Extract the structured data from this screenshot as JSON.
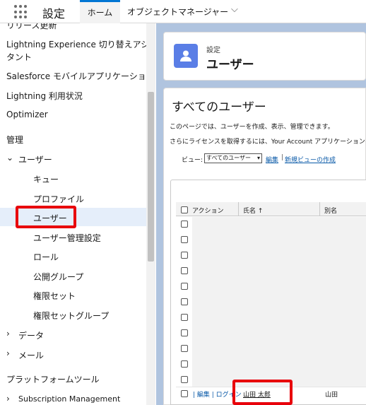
{
  "topbar": {
    "app_title": "設定",
    "tabs": [
      {
        "label": "ホーム",
        "active": true
      },
      {
        "label": "オブジェクトマネージャー",
        "active": false
      }
    ]
  },
  "sidebar": {
    "items": [
      {
        "label": "リリース更新"
      },
      {
        "label": "Lightning Experience 切り替えアシス"
      },
      {
        "label": "タント"
      },
      {
        "label": "Salesforce モバイルアプリケーション"
      },
      {
        "label": "Lightning 利用状況"
      },
      {
        "label": "Optimizer"
      },
      {
        "label": "管理"
      },
      {
        "label": "ユーザー",
        "expanded": true
      },
      {
        "label": "キュー"
      },
      {
        "label": "プロファイル"
      },
      {
        "label": "ユーザー",
        "selected": true
      },
      {
        "label": "ユーザー管理設定"
      },
      {
        "label": "ロール"
      },
      {
        "label": "公開グループ"
      },
      {
        "label": "権限セット"
      },
      {
        "label": "権限セットグループ"
      },
      {
        "label": "データ"
      },
      {
        "label": "メール"
      },
      {
        "label": "プラットフォームツール"
      },
      {
        "label": "Subscription Management"
      }
    ],
    "expand_glyph": "⌄",
    "collapse_glyph": "›"
  },
  "header": {
    "label": "設定",
    "title": "ユーザー",
    "icon": "user-icon",
    "icon_color": "#5a7ee6"
  },
  "main": {
    "heading": "すべてのユーザー",
    "description_1": "このページでは、ユーザーを作成、表示、管理できます。",
    "description_2": "さらにライセンスを取得するには、Your Account アプリケーションを使",
    "view_label": "ビュー:",
    "view_selected": "すべてのユーザー",
    "edit_link": "編集",
    "separator": "|",
    "new_view_link": "新規ビューの作成"
  },
  "table": {
    "columns": [
      "アクション",
      "氏名 ↑",
      "別名"
    ],
    "row": {
      "actions": "| 編集 | ログイン",
      "name": "山田 太郎",
      "alias": "山田"
    }
  },
  "colors": {
    "accent": "#0176d3",
    "highlight": "#e8000b",
    "background": "#b0c4df"
  }
}
